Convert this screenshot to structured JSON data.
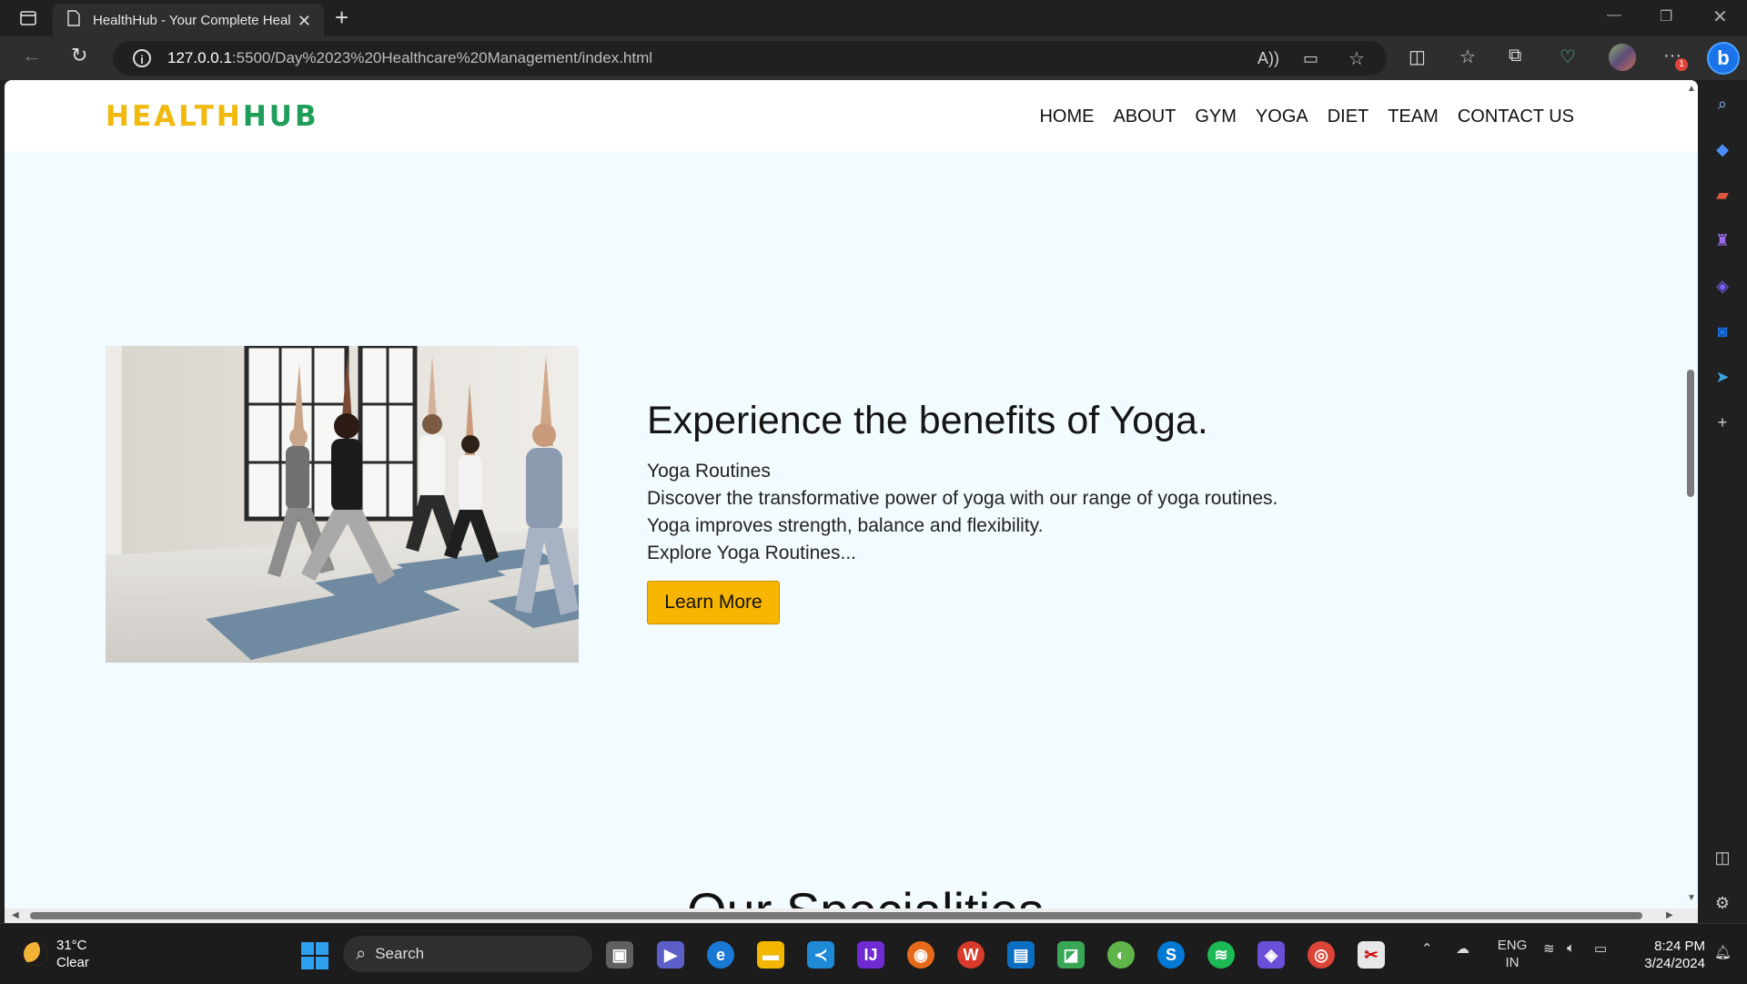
{
  "browser": {
    "tab_title": "HealthHub - Your Complete Heal",
    "url_host": "127.0.0.1",
    "url_rest": ":5500/Day%2023%20Healthcare%20Management/index.html",
    "notification_count": "1"
  },
  "site": {
    "logo_part1": "HEALTH",
    "logo_part2": "HUB",
    "nav": [
      "HOME",
      "ABOUT",
      "GYM",
      "YOGA",
      "DIET",
      "TEAM",
      "CONTACT US"
    ],
    "hero": {
      "heading": "Experience the benefits of Yoga.",
      "lines": [
        "Yoga Routines",
        "Discover the transformative power of yoga with our range of yoga routines.",
        "Yoga improves strength, balance and flexibility.",
        "Explore Yoga Routines..."
      ],
      "button": "Learn More"
    },
    "next_section_title": "Our Specialities"
  },
  "taskbar": {
    "temperature": "31°C",
    "condition": "Clear",
    "search_label": "Search",
    "lang": "ENG",
    "region": "IN",
    "time": "8:24 PM",
    "date": "3/24/2024"
  },
  "colors": {
    "logo_primary": "#f0b90b",
    "logo_secondary": "#1f9e59",
    "page_bg": "#f2fbff",
    "button_bg": "#f7b500"
  }
}
